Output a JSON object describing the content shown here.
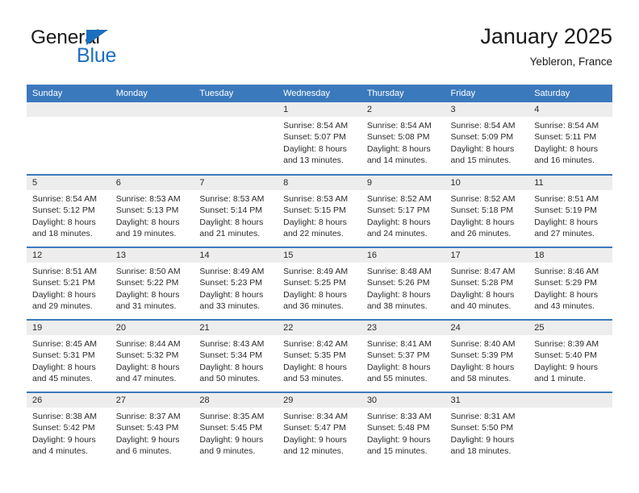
{
  "logo": {
    "word_one": "General",
    "word_two": "Blue",
    "triangle_icon": "triangle-icon",
    "brand_color": "#1b6fc1"
  },
  "header": {
    "title": "January 2025",
    "subtitle": "Yebleron, France"
  },
  "theme": {
    "header_blue": "#3b79bd",
    "daynum_gray": "#ededed",
    "text": "#2b2b2b"
  },
  "calendar": {
    "weekday_headers": [
      "Sunday",
      "Monday",
      "Tuesday",
      "Wednesday",
      "Thursday",
      "Friday",
      "Saturday"
    ],
    "weeks": [
      [
        {
          "day": "",
          "sunrise": "",
          "sunset": "",
          "daylight_1": "",
          "daylight_2": ""
        },
        {
          "day": "",
          "sunrise": "",
          "sunset": "",
          "daylight_1": "",
          "daylight_2": ""
        },
        {
          "day": "",
          "sunrise": "",
          "sunset": "",
          "daylight_1": "",
          "daylight_2": ""
        },
        {
          "day": "1",
          "sunrise": "Sunrise: 8:54 AM",
          "sunset": "Sunset: 5:07 PM",
          "daylight_1": "Daylight: 8 hours",
          "daylight_2": "and 13 minutes."
        },
        {
          "day": "2",
          "sunrise": "Sunrise: 8:54 AM",
          "sunset": "Sunset: 5:08 PM",
          "daylight_1": "Daylight: 8 hours",
          "daylight_2": "and 14 minutes."
        },
        {
          "day": "3",
          "sunrise": "Sunrise: 8:54 AM",
          "sunset": "Sunset: 5:09 PM",
          "daylight_1": "Daylight: 8 hours",
          "daylight_2": "and 15 minutes."
        },
        {
          "day": "4",
          "sunrise": "Sunrise: 8:54 AM",
          "sunset": "Sunset: 5:11 PM",
          "daylight_1": "Daylight: 8 hours",
          "daylight_2": "and 16 minutes."
        }
      ],
      [
        {
          "day": "5",
          "sunrise": "Sunrise: 8:54 AM",
          "sunset": "Sunset: 5:12 PM",
          "daylight_1": "Daylight: 8 hours",
          "daylight_2": "and 18 minutes."
        },
        {
          "day": "6",
          "sunrise": "Sunrise: 8:53 AM",
          "sunset": "Sunset: 5:13 PM",
          "daylight_1": "Daylight: 8 hours",
          "daylight_2": "and 19 minutes."
        },
        {
          "day": "7",
          "sunrise": "Sunrise: 8:53 AM",
          "sunset": "Sunset: 5:14 PM",
          "daylight_1": "Daylight: 8 hours",
          "daylight_2": "and 21 minutes."
        },
        {
          "day": "8",
          "sunrise": "Sunrise: 8:53 AM",
          "sunset": "Sunset: 5:15 PM",
          "daylight_1": "Daylight: 8 hours",
          "daylight_2": "and 22 minutes."
        },
        {
          "day": "9",
          "sunrise": "Sunrise: 8:52 AM",
          "sunset": "Sunset: 5:17 PM",
          "daylight_1": "Daylight: 8 hours",
          "daylight_2": "and 24 minutes."
        },
        {
          "day": "10",
          "sunrise": "Sunrise: 8:52 AM",
          "sunset": "Sunset: 5:18 PM",
          "daylight_1": "Daylight: 8 hours",
          "daylight_2": "and 26 minutes."
        },
        {
          "day": "11",
          "sunrise": "Sunrise: 8:51 AM",
          "sunset": "Sunset: 5:19 PM",
          "daylight_1": "Daylight: 8 hours",
          "daylight_2": "and 27 minutes."
        }
      ],
      [
        {
          "day": "12",
          "sunrise": "Sunrise: 8:51 AM",
          "sunset": "Sunset: 5:21 PM",
          "daylight_1": "Daylight: 8 hours",
          "daylight_2": "and 29 minutes."
        },
        {
          "day": "13",
          "sunrise": "Sunrise: 8:50 AM",
          "sunset": "Sunset: 5:22 PM",
          "daylight_1": "Daylight: 8 hours",
          "daylight_2": "and 31 minutes."
        },
        {
          "day": "14",
          "sunrise": "Sunrise: 8:49 AM",
          "sunset": "Sunset: 5:23 PM",
          "daylight_1": "Daylight: 8 hours",
          "daylight_2": "and 33 minutes."
        },
        {
          "day": "15",
          "sunrise": "Sunrise: 8:49 AM",
          "sunset": "Sunset: 5:25 PM",
          "daylight_1": "Daylight: 8 hours",
          "daylight_2": "and 36 minutes."
        },
        {
          "day": "16",
          "sunrise": "Sunrise: 8:48 AM",
          "sunset": "Sunset: 5:26 PM",
          "daylight_1": "Daylight: 8 hours",
          "daylight_2": "and 38 minutes."
        },
        {
          "day": "17",
          "sunrise": "Sunrise: 8:47 AM",
          "sunset": "Sunset: 5:28 PM",
          "daylight_1": "Daylight: 8 hours",
          "daylight_2": "and 40 minutes."
        },
        {
          "day": "18",
          "sunrise": "Sunrise: 8:46 AM",
          "sunset": "Sunset: 5:29 PM",
          "daylight_1": "Daylight: 8 hours",
          "daylight_2": "and 43 minutes."
        }
      ],
      [
        {
          "day": "19",
          "sunrise": "Sunrise: 8:45 AM",
          "sunset": "Sunset: 5:31 PM",
          "daylight_1": "Daylight: 8 hours",
          "daylight_2": "and 45 minutes."
        },
        {
          "day": "20",
          "sunrise": "Sunrise: 8:44 AM",
          "sunset": "Sunset: 5:32 PM",
          "daylight_1": "Daylight: 8 hours",
          "daylight_2": "and 47 minutes."
        },
        {
          "day": "21",
          "sunrise": "Sunrise: 8:43 AM",
          "sunset": "Sunset: 5:34 PM",
          "daylight_1": "Daylight: 8 hours",
          "daylight_2": "and 50 minutes."
        },
        {
          "day": "22",
          "sunrise": "Sunrise: 8:42 AM",
          "sunset": "Sunset: 5:35 PM",
          "daylight_1": "Daylight: 8 hours",
          "daylight_2": "and 53 minutes."
        },
        {
          "day": "23",
          "sunrise": "Sunrise: 8:41 AM",
          "sunset": "Sunset: 5:37 PM",
          "daylight_1": "Daylight: 8 hours",
          "daylight_2": "and 55 minutes."
        },
        {
          "day": "24",
          "sunrise": "Sunrise: 8:40 AM",
          "sunset": "Sunset: 5:39 PM",
          "daylight_1": "Daylight: 8 hours",
          "daylight_2": "and 58 minutes."
        },
        {
          "day": "25",
          "sunrise": "Sunrise: 8:39 AM",
          "sunset": "Sunset: 5:40 PM",
          "daylight_1": "Daylight: 9 hours",
          "daylight_2": "and 1 minute."
        }
      ],
      [
        {
          "day": "26",
          "sunrise": "Sunrise: 8:38 AM",
          "sunset": "Sunset: 5:42 PM",
          "daylight_1": "Daylight: 9 hours",
          "daylight_2": "and 4 minutes."
        },
        {
          "day": "27",
          "sunrise": "Sunrise: 8:37 AM",
          "sunset": "Sunset: 5:43 PM",
          "daylight_1": "Daylight: 9 hours",
          "daylight_2": "and 6 minutes."
        },
        {
          "day": "28",
          "sunrise": "Sunrise: 8:35 AM",
          "sunset": "Sunset: 5:45 PM",
          "daylight_1": "Daylight: 9 hours",
          "daylight_2": "and 9 minutes."
        },
        {
          "day": "29",
          "sunrise": "Sunrise: 8:34 AM",
          "sunset": "Sunset: 5:47 PM",
          "daylight_1": "Daylight: 9 hours",
          "daylight_2": "and 12 minutes."
        },
        {
          "day": "30",
          "sunrise": "Sunrise: 8:33 AM",
          "sunset": "Sunset: 5:48 PM",
          "daylight_1": "Daylight: 9 hours",
          "daylight_2": "and 15 minutes."
        },
        {
          "day": "31",
          "sunrise": "Sunrise: 8:31 AM",
          "sunset": "Sunset: 5:50 PM",
          "daylight_1": "Daylight: 9 hours",
          "daylight_2": "and 18 minutes."
        },
        {
          "day": "",
          "sunrise": "",
          "sunset": "",
          "daylight_1": "",
          "daylight_2": ""
        }
      ]
    ]
  }
}
